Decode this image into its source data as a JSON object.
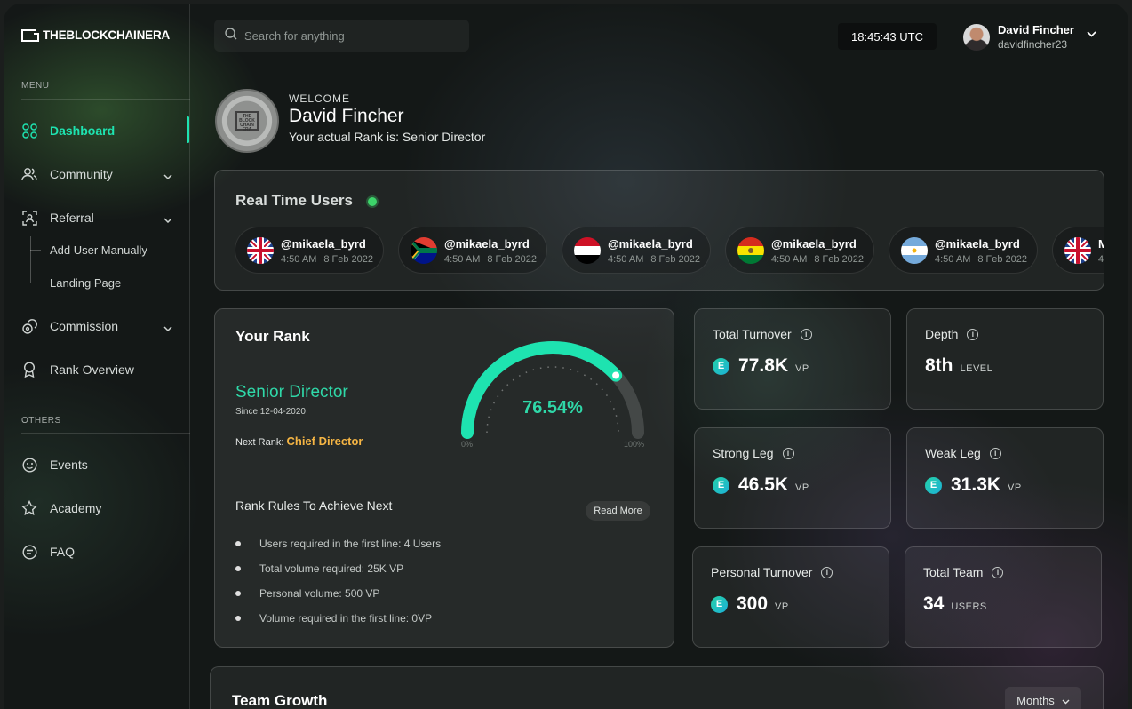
{
  "brand": {
    "logo_text": "THEBLOCKCHAINERA"
  },
  "sidebar": {
    "menu_label": "MENU",
    "others_label": "OTHERS",
    "items": [
      {
        "label": "Dashboard",
        "icon": "grid-icon",
        "active": true
      },
      {
        "label": "Community",
        "icon": "users-icon"
      },
      {
        "label": "Referral",
        "icon": "referral-icon"
      },
      {
        "label": "Commission",
        "icon": "coins-icon"
      },
      {
        "label": "Rank Overview",
        "icon": "award-icon"
      }
    ],
    "referral_sub": [
      "Add User Manually",
      "Landing Page"
    ],
    "others": [
      {
        "label": "Events",
        "icon": "events-icon"
      },
      {
        "label": "Academy",
        "icon": "star-icon"
      },
      {
        "label": "FAQ",
        "icon": "faq-icon"
      }
    ]
  },
  "topbar": {
    "search_placeholder": "Search for anything",
    "clock": "18:45:43 UTC",
    "user_name": "David Fincher",
    "user_handle": "davidfincher23"
  },
  "welcome": {
    "greeting": "WELCOME",
    "name": "David Fincher",
    "rank_text": "Your actual Rank is: Senior Director",
    "badge_text": "THE BLOCK CHAIN ERA"
  },
  "realtime": {
    "title": "Real Time Users",
    "users": [
      {
        "handle": "@mikaela_byrd",
        "time": "4:50 AM",
        "date": "8 Feb 2022",
        "flag": "uk"
      },
      {
        "handle": "@mikaela_byrd",
        "time": "4:50 AM",
        "date": "8 Feb 2022",
        "flag": "za"
      },
      {
        "handle": "@mikaela_byrd",
        "time": "4:50 AM",
        "date": "8 Feb 2022",
        "flag": "ye"
      },
      {
        "handle": "@mikaela_byrd",
        "time": "4:50 AM",
        "date": "8 Feb 2022",
        "flag": "bo"
      },
      {
        "handle": "@mikaela_byrd",
        "time": "4:50 AM",
        "date": "8 Feb 2022",
        "flag": "ar"
      },
      {
        "handle": "M",
        "time": "4:",
        "date": "",
        "flag": "uk"
      }
    ]
  },
  "rank": {
    "title": "Your Rank",
    "current": "Senior Director",
    "since": "Since 12-04-2020",
    "next_label": "Next Rank:",
    "next": "Chief Director",
    "progress_percent": 76.54,
    "progress_text": "76.54%",
    "min_label": "0%",
    "max_label": "100%",
    "rules_title": "Rank Rules To Achieve Next",
    "read_more": "Read More",
    "rules": [
      "Users required in the first line: 4 Users",
      "Total volume required: 25K VP",
      "Personal volume: 500 VP",
      "Volume required in the first line: 0VP"
    ],
    "accent": "#1ee3b0"
  },
  "stats": {
    "total_turnover": {
      "label": "Total Turnover",
      "value": "77.8K",
      "unit": "VP"
    },
    "depth": {
      "label": "Depth",
      "value": "8th",
      "unit": "LEVEL"
    },
    "strong_leg": {
      "label": "Strong Leg",
      "value": "46.5K",
      "unit": "VP"
    },
    "weak_leg": {
      "label": "Weak Leg",
      "value": "31.3K",
      "unit": "VP"
    },
    "personal_turnover": {
      "label": "Personal Turnover",
      "value": "300",
      "unit": "VP"
    },
    "total_team": {
      "label": "Total Team",
      "value": "34",
      "unit": "USERS"
    },
    "coin_symbol": "E"
  },
  "team_growth": {
    "title": "Team Growth",
    "period": "Months"
  }
}
